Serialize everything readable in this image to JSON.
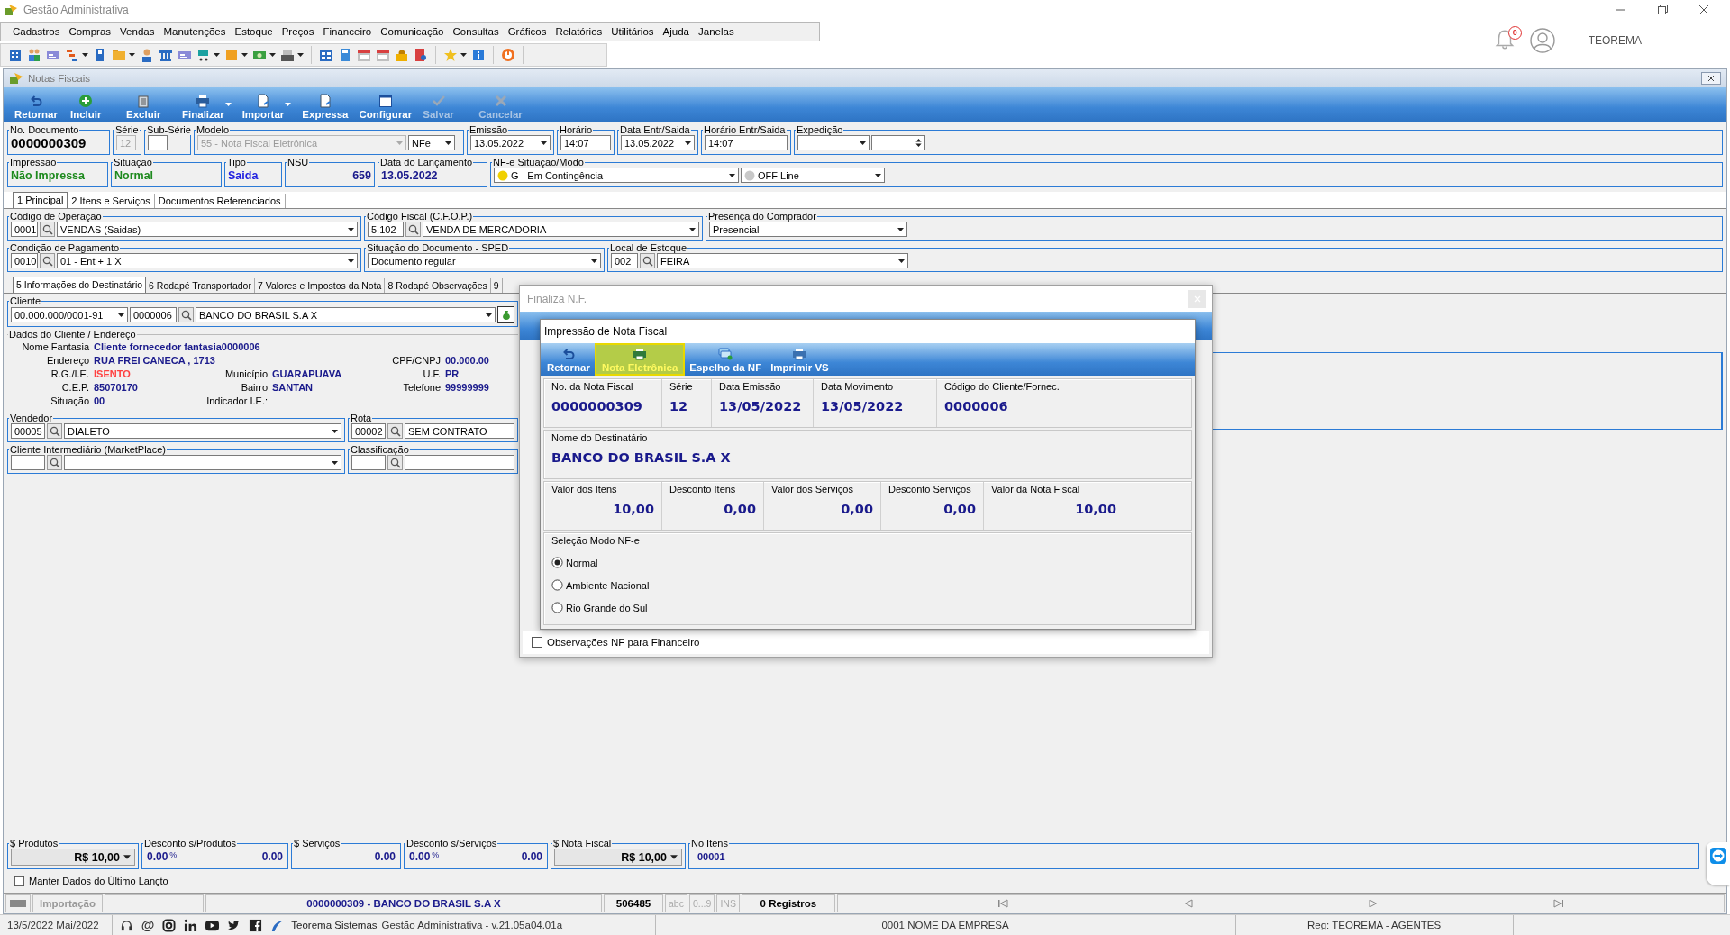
{
  "app": {
    "title": "Gestão Administrativa",
    "notifications": "0",
    "user": "TEOREMA"
  },
  "menu": [
    "Cadastros",
    "Compras",
    "Vendas",
    "Manutenções",
    "Estoque",
    "Preços",
    "Financeiro",
    "Comunicação",
    "Consultas",
    "Gráficos",
    "Relatórios",
    "Utilitários",
    "Ajuda",
    "Janelas"
  ],
  "window": {
    "title": "Notas Fiscais"
  },
  "actions": [
    {
      "label": "Retornar",
      "disabled": false,
      "dropdown": false
    },
    {
      "label": "Incluir",
      "disabled": false,
      "dropdown": false
    },
    {
      "label": "Excluir",
      "disabled": false,
      "dropdown": false
    },
    {
      "label": "Finalizar",
      "disabled": false,
      "dropdown": true
    },
    {
      "label": "Importar",
      "disabled": false,
      "dropdown": true
    },
    {
      "label": "Expressa",
      "disabled": false,
      "dropdown": false
    },
    {
      "label": "Configurar",
      "disabled": false,
      "dropdown": false
    },
    {
      "label": "Salvar",
      "disabled": true,
      "dropdown": false
    },
    {
      "label": "Cancelar",
      "disabled": true,
      "dropdown": false
    }
  ],
  "documento": {
    "numero": {
      "label": "No. Documento",
      "value": "0000000309"
    },
    "serie": {
      "label": "Série",
      "value": "12",
      "disabled": true
    },
    "sub_serie": {
      "label": "Sub-Série"
    },
    "modelo": {
      "label": "Modelo",
      "value": "55 - Nota Fiscal Eletrônica",
      "disabled": true,
      "tipo": "NFe"
    },
    "emissao": {
      "label": "Emissão",
      "value": "13.05.2022"
    },
    "horario": {
      "label": "Horário",
      "value": "14:07"
    },
    "data_entr": {
      "label": "Data Entr/Saida",
      "value": "13.05.2022"
    },
    "horario_entr": {
      "label": "Horário Entr/Saida",
      "value": "14:07"
    },
    "expedicao": {
      "label": "Expedição"
    }
  },
  "situacao": {
    "impressao": {
      "label": "Impressão",
      "value": "Não Impressa"
    },
    "situacao": {
      "label": "Situação",
      "value": "Normal"
    },
    "tipo": {
      "label": "Tipo",
      "value": "Saida"
    },
    "nsu": {
      "label": "NSU",
      "value": "659"
    },
    "lancamento": {
      "label": "Data do Lançamento",
      "value": "13.05.2022"
    },
    "nfe": {
      "label": "NF-e Situação/Modo",
      "value": "G - Em Contingência",
      "mode": "OFF Line"
    }
  },
  "tabs": [
    {
      "label": "1 Principal",
      "selected": true
    },
    {
      "label": "2 Itens e Serviços",
      "selected": false
    },
    {
      "label": "Documentos Referenciados",
      "selected": false
    }
  ],
  "principal": {
    "operacao": {
      "label": "Código de Operação",
      "code": "0001",
      "value": "VENDAS (Saidas)"
    },
    "cfop": {
      "label": "Código Fiscal (C.F.O.P.)",
      "code": "5.102",
      "value": "VENDA DE MERCADORIA"
    },
    "presenca": {
      "label": "Presença do Comprador",
      "value": "Presencial"
    },
    "pagamento": {
      "label": "Condição de Pagamento",
      "code": "0010",
      "value": "01 - Ent + 1 X"
    },
    "sped": {
      "label": "Situação do Documento - SPED",
      "value": "Documento regular"
    },
    "estoque": {
      "label": "Local de Estoque",
      "code": "002",
      "value": "FEIRA"
    }
  },
  "subtabs": [
    {
      "label": "5 Informações do Destinatário",
      "selected": true
    },
    {
      "label": "6 Rodapé Transportador",
      "selected": false
    },
    {
      "label": "7 Valores e Impostos da Nota",
      "selected": false
    },
    {
      "label": "8 Rodapé Observações",
      "selected": false
    },
    {
      "label": "9",
      "selected": false
    }
  ],
  "cliente": {
    "label": "Cliente",
    "cnpj": "00.000.000/0001-91",
    "code": "0000006",
    "name": "BANCO DO BRASIL S.A X"
  },
  "dados": {
    "label": "Dados do Cliente / Endereço",
    "rows": [
      {
        "col1": {
          "label": "Nome Fantasia",
          "value": "Cliente fornecedor fantasia0000006",
          "highlight": false
        }
      },
      {
        "col1": {
          "label": "Endereço",
          "value": "RUA FREI CANECA , 1713",
          "highlight": false
        },
        "col3": {
          "label": "CPF/CNPJ",
          "value": "00.000.00",
          "highlight": false
        }
      },
      {
        "col1": {
          "label": "R.G./I.E.",
          "value": "ISENTO",
          "highlight": true
        },
        "col2": {
          "label": "Município",
          "value": "GUARAPUAVA",
          "highlight": false
        },
        "col3": {
          "label": "U.F.",
          "value": "PR",
          "highlight": false
        }
      },
      {
        "col1": {
          "label": "C.E.P.",
          "value": "85070170",
          "highlight": false
        },
        "col2": {
          "label": "Bairro",
          "value": "SANTAN",
          "highlight": false
        },
        "col3": {
          "label": "Telefone",
          "value": "99999999",
          "highlight": false
        }
      },
      {
        "col1": {
          "label": "Situação",
          "value": "00",
          "highlight": false
        },
        "col2": {
          "label": "Indicador I.E.:"
        }
      }
    ]
  },
  "vendedor": {
    "label": "Vendedor",
    "code": "00005",
    "value": "DIALETO"
  },
  "rota": {
    "label": "Rota",
    "code": "00002",
    "value": "SEM CONTRATO"
  },
  "intermediario": {
    "label": "Cliente Intermediário (MarketPlace)"
  },
  "classificacao": {
    "label": "Classificação"
  },
  "totals": [
    {
      "kind": "money",
      "label": "$ Produtos",
      "value": "R$ 10,00"
    },
    {
      "kind": "discount",
      "label": "Desconto s/Produtos",
      "percent": "0.00",
      "unit": "%",
      "value": "0.00"
    },
    {
      "kind": "amount",
      "label": "$ Serviços",
      "value": "0.00"
    },
    {
      "kind": "discount",
      "label": "Desconto s/Serviços",
      "percent": "0.00",
      "unit": "%",
      "value": "0.00"
    },
    {
      "kind": "money",
      "label": "$ Nota Fiscal",
      "value": "R$ 10,00"
    },
    {
      "kind": "count",
      "label": "No Itens",
      "value": "00001"
    }
  ],
  "keep_data": {
    "label": "Manter Dados do Último Lançto",
    "checked": false
  },
  "statusbar": {
    "module": "Importação",
    "record": "0000000309 - BANCO DO BRASIL S.A X",
    "number": "506485",
    "indicators": [
      "abc",
      "0...9",
      "INS"
    ],
    "count": "0 Registros"
  },
  "footer": {
    "date": "13/5/2022 Mai/2022",
    "email_symbol": "@",
    "link": "Teorema Sistemas",
    "version": "Gestão Administrativa - v.21.05a04.01a",
    "company": "0001 NOME DA EMPRESA",
    "reg": "Reg: TEOREMA - AGENTES"
  },
  "finaliza": {
    "title": "Finaliza N.F.",
    "obs": {
      "label": "Observações NF para Financeiro",
      "checked": false
    }
  },
  "impressao": {
    "title": "Impressão de Nota Fiscal",
    "actions": [
      {
        "label": "Retornar",
        "selected": false
      },
      {
        "label": "Nota Eletrônica",
        "selected": true
      },
      {
        "label": "Espelho da NF",
        "selected": false
      },
      {
        "label": "Imprimir VS",
        "selected": false
      }
    ],
    "info": [
      {
        "label": "No. da Nota Fiscal",
        "value": "0000000309"
      },
      {
        "label": "Série",
        "value": "12"
      },
      {
        "label": "Data Emissão",
        "value": "13/05/2022"
      },
      {
        "label": "Data Movimento",
        "value": "13/05/2022"
      },
      {
        "label": "Código do Cliente/Fornec.",
        "value": "0000006"
      }
    ],
    "destinatario": {
      "label": "Nome do Destinatário",
      "value": "BANCO DO BRASIL S.A X"
    },
    "valores": [
      {
        "label": "Valor dos Itens",
        "value": "10,00"
      },
      {
        "label": "Desconto Itens",
        "value": "0,00"
      },
      {
        "label": "Valor dos Serviços",
        "value": "0,00"
      },
      {
        "label": "Desconto Serviços",
        "value": "0,00"
      },
      {
        "label": "Valor da Nota Fiscal",
        "value": "10,00"
      }
    ],
    "modo": {
      "label": "Seleção Modo NF-e",
      "options": [
        {
          "label": "Normal",
          "selected": true
        },
        {
          "label": "Ambiente Nacional",
          "selected": false
        },
        {
          "label": "Rio Grande do Sul",
          "selected": false
        }
      ]
    }
  }
}
